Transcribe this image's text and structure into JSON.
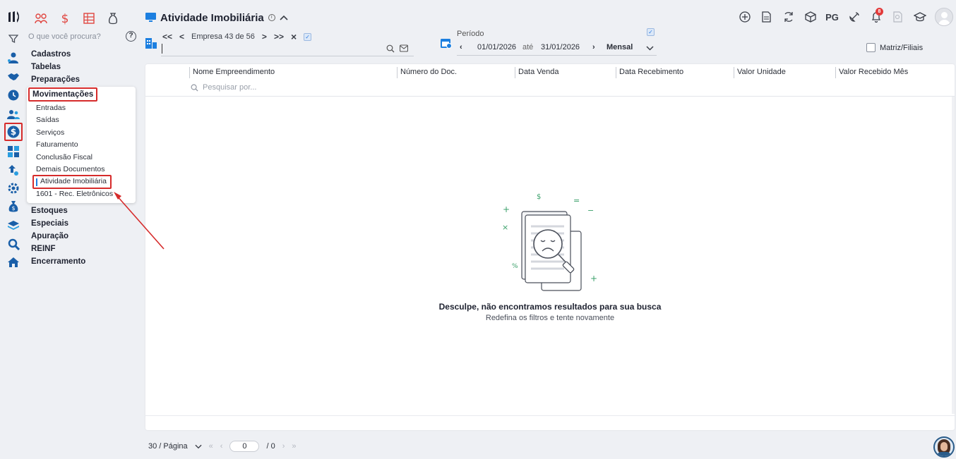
{
  "colors": {
    "accent_red": "#d62b2b",
    "brand_blue": "#1c7fe0",
    "icon_blue": "#1a5fa8"
  },
  "sidebar": {
    "search_placeholder": "O que você procura?",
    "help_label": "?",
    "menu_top": [
      "Cadastros",
      "Tabelas",
      "Preparações"
    ],
    "open_group": {
      "label": "Movimentações",
      "items": [
        "Entradas",
        "Saídas",
        "Serviços",
        "Faturamento",
        "Conclusão Fiscal",
        "Demais Documentos",
        "Atividade Imobiliária",
        "1601 - Rec. Eletrônicos"
      ]
    },
    "menu_bottom": [
      "Estoques",
      "Especiais",
      "Apuração",
      "REINF",
      "Encerramento"
    ]
  },
  "header": {
    "title": "Atividade Imobiliária",
    "right_icons": [
      "plus-circle-icon",
      "document-icon",
      "refresh-icon",
      "box-icon",
      "pg-label",
      "satellite-icon",
      "bell-icon",
      "report-icon",
      "graduation-cap-icon"
    ],
    "pg_label": "PG",
    "notification_count": "8"
  },
  "company_nav": {
    "first": "<<",
    "prev": "<",
    "label": "Empresa 43 de 56",
    "next": ">",
    "last": ">>",
    "clear": "×",
    "company_value": ""
  },
  "period": {
    "label": "Período",
    "start": "01/01/2026",
    "connector": "até",
    "end": "31/01/2026",
    "mode": "Mensal"
  },
  "matriz_filiais": {
    "label": "Matriz/Filiais",
    "checked": false
  },
  "table": {
    "columns": [
      "Nome Empreendimento",
      "Número do Doc.",
      "Data Venda",
      "Data Recebimento",
      "Valor Unidade",
      "Valor Recebido Mês"
    ],
    "filter_placeholder": "Pesquisar por...",
    "rows": []
  },
  "empty_state": {
    "title": "Desculpe, não encontramos resultados para sua busca",
    "subtitle": "Redefina os filtros e tente novamente"
  },
  "pagination": {
    "page_size": "30 / Página",
    "current_page": "0",
    "total_pages": "/ 0"
  }
}
